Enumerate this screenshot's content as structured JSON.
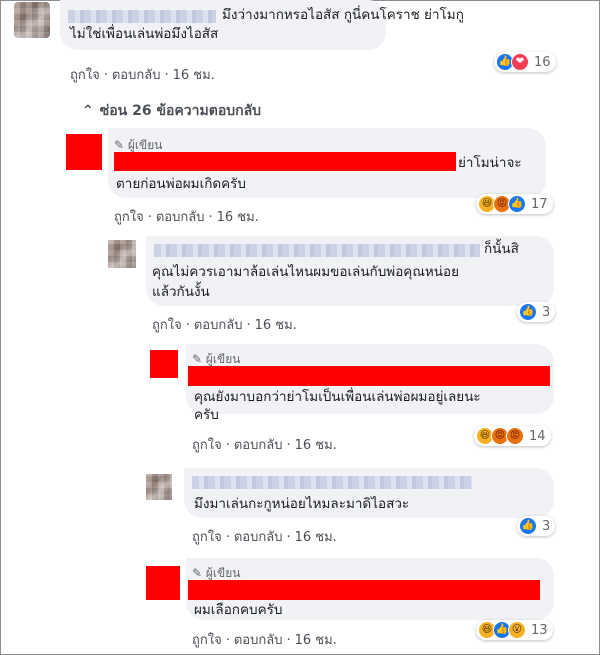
{
  "comments": {
    "c1": {
      "text_line1": "มึงว่างมากหรอไอสัส กูนี่คนโคราช ย่าโมกู",
      "text_line2": "ไม่ใช่เพื่อนเล่นพ่อมึงไอสัส",
      "like": "ถูกใจ",
      "reply": "ตอบกลับ",
      "time": "16 ชม.",
      "reaction_count": "16"
    },
    "replies_toggle": "ซ่อน 26 ข้อความตอบกลับ",
    "c2": {
      "author": "ผู้เขียน",
      "text_line1": "ย่าโมน่าจะ",
      "text_line2": "ตายก่อนพ่อผมเกิดครับ",
      "like": "ถูกใจ",
      "reply": "ตอบกลับ",
      "time": "16 ชม.",
      "reaction_count": "17"
    },
    "c3": {
      "text_line1": "ก็นั้นสิ",
      "text_line2": "คุณไม่ควรเอามาล้อเล่นไหนผมขอเล่นกับพ่อคุณหน่อย",
      "text_line3": "แล้วกันงั้น",
      "like": "ถูกใจ",
      "reply": "ตอบกลับ",
      "time": "16 ชม.",
      "reaction_count": "3"
    },
    "c4": {
      "author": "ผู้เขียน",
      "text_line1": "คุณยังมาบอกว่าย่าโมเป็นเพื่อนเล่นพ่อผมอยู่เลยนะ",
      "text_line2": "ครับ",
      "like": "ถูกใจ",
      "reply": "ตอบกลับ",
      "time": "16 ชม.",
      "reaction_count": "14"
    },
    "c5": {
      "text_line1": "มึงมาเล่นกะกูหน่อยไหมละมาดิไอสวะ",
      "like": "ถูกใจ",
      "reply": "ตอบกลับ",
      "time": "16 ชม.",
      "reaction_count": "3"
    },
    "c6": {
      "author": "ผู้เขียน",
      "text_line1": "ผมเลือกคบครับ",
      "like": "ถูกใจ",
      "reply": "ตอบกลับ",
      "time": "16 ชม.",
      "reaction_count": "13"
    }
  },
  "icons": {
    "pencil": "✎",
    "chevron": "⌃",
    "like": "👍",
    "love": "❤",
    "haha": "😆",
    "angry": "😡",
    "wow": "😮"
  },
  "colors": {
    "redaction": "#ff0000",
    "bubble": "#f0f2f5",
    "like_blue": "#1877f2"
  }
}
